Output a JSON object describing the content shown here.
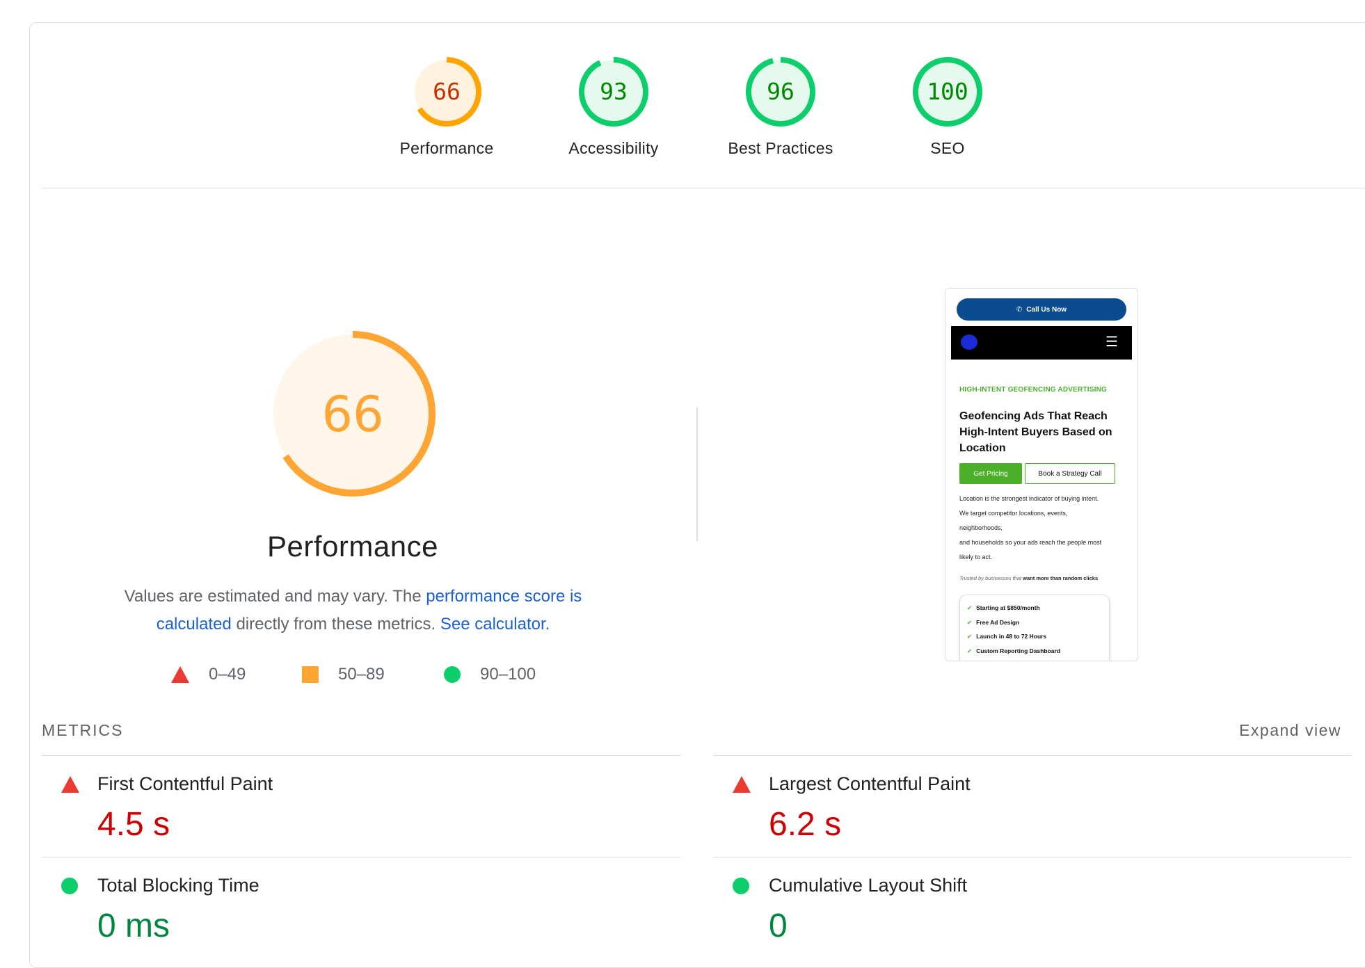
{
  "scores": [
    {
      "label": "Performance",
      "value": "66",
      "score": 66,
      "color": "#ffa400",
      "fill": "#fff3e0",
      "text": "#c33300"
    },
    {
      "label": "Accessibility",
      "value": "93",
      "score": 93,
      "color": "#0cce6b",
      "fill": "#e6f9ee",
      "text": "#008800"
    },
    {
      "label": "Best Practices",
      "value": "96",
      "score": 96,
      "color": "#0cce6b",
      "fill": "#e6f9ee",
      "text": "#008800"
    },
    {
      "label": "SEO",
      "value": "100",
      "score": 100,
      "color": "#0cce6b",
      "fill": "#e6f9ee",
      "text": "#008800"
    }
  ],
  "main": {
    "score": "66",
    "score_value": 66,
    "title": "Performance",
    "desc_pre": "Values are estimated and may vary. The ",
    "desc_link1": "performance score is calculated",
    "desc_mid": " directly from these metrics. ",
    "desc_link2": "See calculator.",
    "accent": "#ffa533",
    "fill": "#fff6ea"
  },
  "legend": {
    "fail": "0–49",
    "average": "50–89",
    "pass": "90–100"
  },
  "screenshot": {
    "call_button": "Call Us Now",
    "menu_icon": "☰",
    "eyebrow": "HIGH-INTENT GEOFENCING ADVERTISING",
    "headline": "Geofencing Ads That Reach High-Intent Buyers Based on Location",
    "btn_primary": "Get Pricing",
    "btn_secondary": "Book a Strategy Call",
    "body_lines": [
      "Location is the strongest indicator of buying intent.",
      "We target competitor locations, events,",
      "neighborhoods,",
      "and households so your ads reach the people most",
      "likely to act."
    ],
    "trusted_pre": "Trusted by businesses that ",
    "trusted_bold": "want more than random clicks",
    "checklist": [
      "Starting at $850/month",
      "Free Ad Design",
      "Launch in 48 to 72 Hours",
      "Custom Reporting Dashboard"
    ]
  },
  "metrics": {
    "header": "METRICS",
    "expand": "Expand view",
    "items": [
      {
        "name": "First Contentful Paint",
        "value": "4.5 s",
        "status": "fail"
      },
      {
        "name": "Largest Contentful Paint",
        "value": "6.2 s",
        "status": "fail"
      },
      {
        "name": "Total Blocking Time",
        "value": "0 ms",
        "status": "pass"
      },
      {
        "name": "Cumulative Layout Shift",
        "value": "0",
        "status": "pass"
      }
    ]
  }
}
